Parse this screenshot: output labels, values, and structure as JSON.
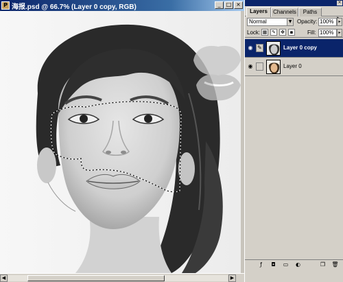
{
  "document": {
    "title": "海报.psd @ 66.7% (Layer 0 copy, RGB)",
    "title_icon": "ps-doc-icon",
    "buttons": {
      "minimize": "_",
      "maximize": "□",
      "close": "×"
    }
  },
  "palette": {
    "tabs": [
      {
        "label": "Layers",
        "active": true
      },
      {
        "label": "Channels",
        "active": false
      },
      {
        "label": "Paths",
        "active": false
      }
    ],
    "menu_icon": "▸",
    "blend_mode": "Normal",
    "opacity_label": "Opacity:",
    "opacity_value": "100%",
    "lock_label": "Lock:",
    "fill_label": "Fill:",
    "fill_value": "100%",
    "lock_icons": [
      "transparency-lock-icon",
      "brush-lock-icon",
      "move-lock-icon",
      "all-lock-icon"
    ],
    "layers": [
      {
        "name": "Layer 0 copy",
        "visible": true,
        "selected": true,
        "link": "brush"
      },
      {
        "name": "Layer 0",
        "visible": true,
        "selected": false,
        "link": ""
      }
    ],
    "bottom_icons": [
      "layer-style-icon",
      "mask-icon",
      "new-set-icon",
      "adjustment-layer-icon",
      "new-layer-icon",
      "trash-icon"
    ]
  },
  "colors": {
    "titlebar_start": "#0a246a",
    "titlebar_end": "#a6caf0",
    "selected_layer": "#0a246a",
    "panel_bg": "#d4d0c8"
  }
}
